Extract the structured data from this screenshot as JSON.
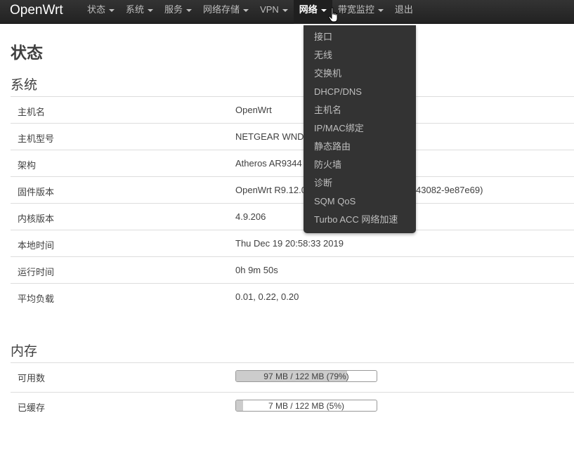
{
  "brand": "OpenWrt",
  "nav": [
    {
      "label": "状态",
      "dropdown": true
    },
    {
      "label": "系统",
      "dropdown": true
    },
    {
      "label": "服务",
      "dropdown": true
    },
    {
      "label": "网络存储",
      "dropdown": true
    },
    {
      "label": "VPN",
      "dropdown": true
    },
    {
      "label": "网络",
      "dropdown": true,
      "active": true
    },
    {
      "label": "带宽监控",
      "dropdown": true
    },
    {
      "label": "退出",
      "dropdown": false
    }
  ],
  "network_menu": [
    "接口",
    "无线",
    "交换机",
    "DHCP/DNS",
    "主机名",
    "IP/MAC绑定",
    "静态路由",
    "防火墙",
    "诊断",
    "SQM QoS",
    "Turbo ACC 网络加速"
  ],
  "page_title": "状态",
  "system": {
    "title": "系统",
    "rows": [
      {
        "label": "主机名",
        "value": "OpenWrt"
      },
      {
        "label": "主机型号",
        "value": "NETGEAR WND"
      },
      {
        "label": "架构",
        "value": "Atheros AR9344"
      },
      {
        "label": "固件版本",
        "value": "OpenWrt R9.12.0",
        "value_suffix": "43082-9e87e69)"
      },
      {
        "label": "内核版本",
        "value": "4.9.206"
      },
      {
        "label": "本地时间",
        "value": "Thu Dec 19 20:58:33 2019"
      },
      {
        "label": "运行时间",
        "value": "0h 9m 50s"
      },
      {
        "label": "平均负载",
        "value": "0.01, 0.22, 0.20"
      }
    ]
  },
  "memory": {
    "title": "内存",
    "rows": [
      {
        "label": "可用数",
        "text": "97 MB / 122 MB (79%)",
        "percent": 79
      },
      {
        "label": "已缓存",
        "text": "7 MB / 122 MB (5%)",
        "percent": 5
      }
    ]
  }
}
